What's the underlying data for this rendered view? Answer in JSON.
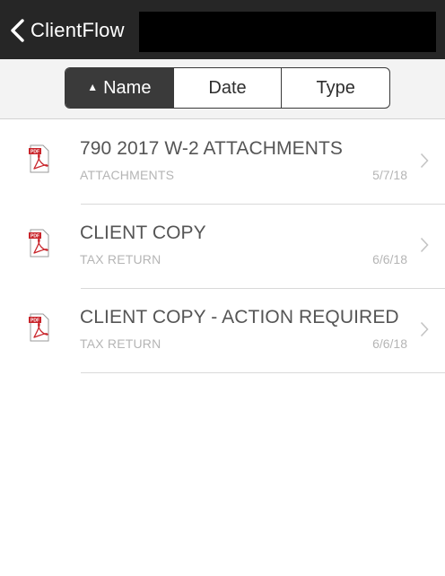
{
  "navbar": {
    "back_label": "ClientFlow",
    "back_icon": "chevron-left-icon",
    "background": "#262626"
  },
  "sort_control": {
    "options": [
      {
        "label": "Name",
        "active": true,
        "indicator": "▲"
      },
      {
        "label": "Date",
        "active": false
      },
      {
        "label": "Type",
        "active": false
      }
    ],
    "active_color": "#3a3a3a"
  },
  "documents": [
    {
      "title": "790 2017 W-2 ATTACHMENTS",
      "category": "ATTACHMENTS",
      "date": "5/7/18",
      "icon": "pdf-icon"
    },
    {
      "title": "CLIENT COPY",
      "category": "TAX RETURN",
      "date": "6/6/18",
      "icon": "pdf-icon"
    },
    {
      "title": "CLIENT COPY - ACTION REQUIRED",
      "category": "TAX RETURN",
      "date": "6/6/18",
      "icon": "pdf-icon"
    }
  ],
  "colors": {
    "pdf_red": "#c9252b",
    "title_text": "#555555",
    "meta_text": "#b5b5b5"
  }
}
